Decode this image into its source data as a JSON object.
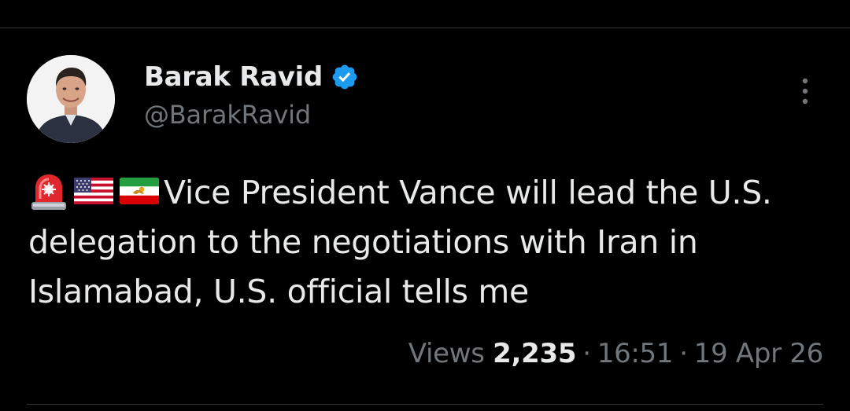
{
  "author": {
    "display_name": "Barak Ravid",
    "handle": "@BarakRavid",
    "verified": true
  },
  "tweet": {
    "emojis": [
      "siren-emoji",
      "us-flag-emoji",
      "iran-lion-sun-flag-emoji"
    ],
    "text": "Vice President Vance will lead the U.S. delegation to the negotiations with Iran in Islamabad, U.S. official tells me"
  },
  "meta": {
    "views_label": "Views",
    "views_count": "2,235",
    "separator": "·",
    "time": "16:51",
    "date": "19 Apr 26"
  },
  "colors": {
    "background": "#000000",
    "text_primary": "#e7e9ea",
    "text_secondary": "#71767b",
    "verified_blue": "#1d9bf0",
    "divider": "#2f3336"
  }
}
